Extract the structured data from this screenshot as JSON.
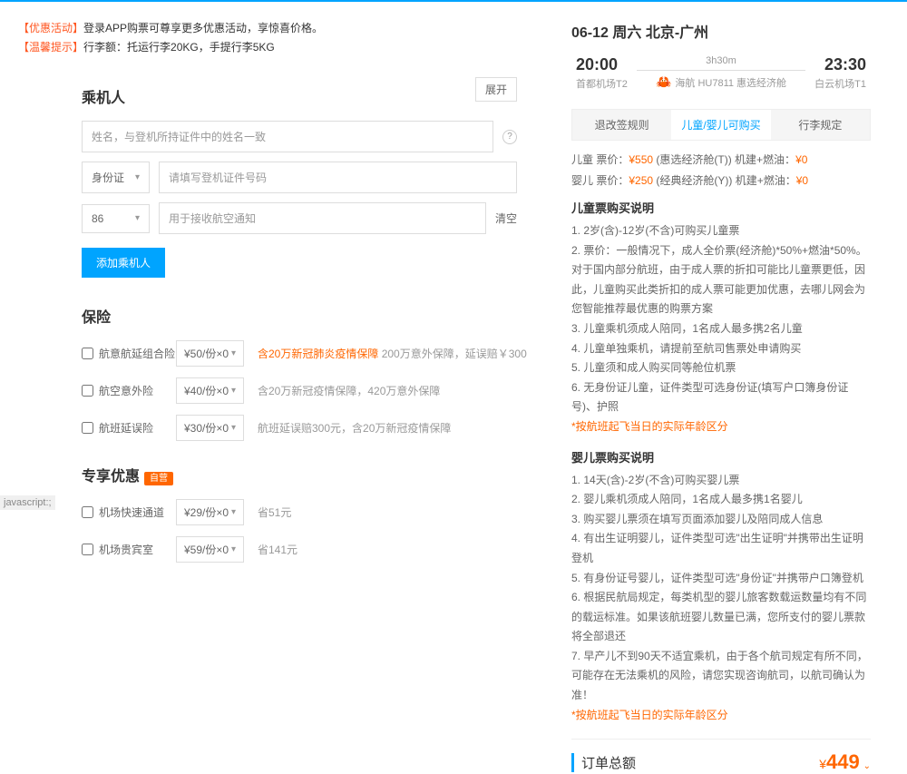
{
  "notices": {
    "promo_tag": "【优惠活动】",
    "promo_text": "登录APP购票可尊享更多优惠活动，享惊喜价格。",
    "tip_tag": "【温馨提示】",
    "tip_text": "行李额：托运行李20KG，手提行李5KG"
  },
  "passenger": {
    "title": "乘机人",
    "expand": "展开",
    "name_placeholder": "姓名，与登机所持证件中的姓名一致",
    "id_type": "身份证",
    "id_placeholder": "请填写登机证件号码",
    "phone_prefix": "86",
    "phone_placeholder": "用于接收航空通知",
    "clear": "清空",
    "add_btn": "添加乘机人"
  },
  "insurance": {
    "title": "保险",
    "items": [
      {
        "name": "航意航延组合险",
        "price": "¥50/份×0",
        "desc_pre": "含20万新冠肺炎疫情保障",
        "desc_suf": "  200万意外保障，延误赔￥300"
      },
      {
        "name": "航空意外险",
        "price": "¥40/份×0",
        "desc_pre": "",
        "desc_suf": "含20万新冠疫情保障，420万意外保障"
      },
      {
        "name": "航班延误险",
        "price": "¥30/份×0",
        "desc_pre": "",
        "desc_suf": "航班延误赔300元，含20万新冠疫情保障"
      }
    ]
  },
  "discount": {
    "title": "专享优惠",
    "badge": "自营",
    "items": [
      {
        "name": "机场快速通道",
        "price": "¥29/份×0",
        "save": "省51元"
      },
      {
        "name": "机场贵宾室",
        "price": "¥59/份×0",
        "save": "省141元"
      }
    ]
  },
  "flight": {
    "header": "06-12 周六   北京-广州",
    "dep_time": "20:00",
    "dep_airport": "首都机场T2",
    "duration": "3h30m",
    "airline": "海航 HU7811 惠选经济舱",
    "arr_time": "23:30",
    "arr_airport": "白云机场T1"
  },
  "tabs": {
    "t1": "退改签规则",
    "t2": "儿童/婴儿可购买",
    "t3": "行李规定"
  },
  "prices": {
    "child_label": "儿童 票价：",
    "child_price": "¥550",
    "child_cabin": "(惠选经济舱(T)) 机建+燃油：",
    "child_tax": "¥0",
    "infant_label": "婴儿 票价：",
    "infant_price": "¥250",
    "infant_cabin": "(经典经济舱(Y)) 机建+燃油：",
    "infant_tax": "¥0"
  },
  "child_rules": {
    "title": "儿童票购买说明",
    "r1": "1. 2岁(含)-12岁(不含)可购买儿童票",
    "r2": "2. 票价：一般情况下，成人全价票(经济舱)*50%+燃油*50%。对于国内部分航班，由于成人票的折扣可能比儿童票更低，因此，儿童购买此类折扣的成人票可能更加优惠，去哪儿网会为您智能推荐最优惠的购票方案",
    "r3": "3. 儿童乘机须成人陪同，1名成人最多携2名儿童",
    "r4": "4. 儿童单独乘机，请提前至航司售票处申请购买",
    "r5": "5. 儿童须和成人购买同等舱位机票",
    "r6": "6. 无身份证儿童，证件类型可选身份证(填写户口簿身份证号)、护照",
    "note": "*按航班起飞当日的实际年龄区分"
  },
  "infant_rules": {
    "title": "婴儿票购买说明",
    "r1": "1. 14天(含)-2岁(不含)可购买婴儿票",
    "r2": "2. 婴儿乘机须成人陪同，1名成人最多携1名婴儿",
    "r3": "3. 购买婴儿票须在填写页面添加婴儿及陪同成人信息",
    "r4": "4. 有出生证明婴儿，证件类型可选\"出生证明\"并携带出生证明登机",
    "r5": "5. 有身份证号婴儿，证件类型可选\"身份证\"并携带户口簿登机",
    "r6": "6. 根据民航局规定，每类机型的婴儿旅客数载运数量均有不同的载运标准。如果该航班婴儿数量已满，您所支付的婴儿票款将全部退还",
    "r7": "7. 早产儿不到90天不适宜乘机，由于各个航司规定有所不同，可能存在无法乘机的风险，请您实现咨询航司，以航司确认为准！",
    "note": "*按航班起飞当日的实际年龄区分"
  },
  "order": {
    "label": "订单总额",
    "currency": "¥",
    "amount": "449"
  },
  "status": "javascript:;"
}
